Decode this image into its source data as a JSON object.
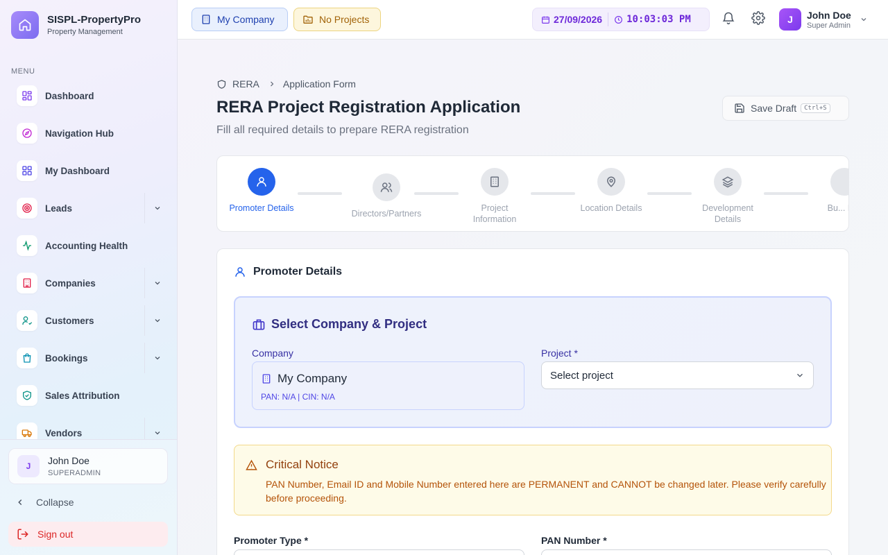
{
  "brand": {
    "name": "SISPL-PropertyPro",
    "subtitle": "Property Management"
  },
  "sidebar": {
    "menu_label": "MENU",
    "items": [
      {
        "label": "Dashboard",
        "icon": "layout-grid-icon",
        "color": "#7c3aed",
        "expandable": false
      },
      {
        "label": "Navigation Hub",
        "icon": "compass-icon",
        "color": "#c026d3",
        "expandable": false
      },
      {
        "label": "My Dashboard",
        "icon": "grid-icon",
        "color": "#4f46e5",
        "expandable": false
      },
      {
        "label": "Leads",
        "icon": "target-icon",
        "color": "#e11d48",
        "expandable": true
      },
      {
        "label": "Accounting Health",
        "icon": "activity-icon",
        "color": "#059669",
        "expandable": false
      },
      {
        "label": "Companies",
        "icon": "building-icon",
        "color": "#e11d48",
        "expandable": true
      },
      {
        "label": "Customers",
        "icon": "user-check-icon",
        "color": "#0d9488",
        "expandable": true
      },
      {
        "label": "Bookings",
        "icon": "shopping-bag-icon",
        "color": "#0891b2",
        "expandable": true
      },
      {
        "label": "Sales Attribution",
        "icon": "shield-check-icon",
        "color": "#0d9488",
        "expandable": false
      },
      {
        "label": "Vendors",
        "icon": "truck-icon",
        "color": "#d97706",
        "expandable": true
      }
    ],
    "user": {
      "initial": "J",
      "name": "John Doe",
      "role": "SUPERADMIN"
    },
    "collapse_label": "Collapse",
    "signout_label": "Sign out"
  },
  "header": {
    "company_chip": "My Company",
    "project_chip": "No Projects",
    "date": "27/09/2026",
    "time": "10:03:03 PM",
    "user": {
      "initial": "J",
      "name": "John Doe",
      "role": "Super Admin"
    }
  },
  "breadcrumb": {
    "root": "RERA",
    "current": "Application Form"
  },
  "page": {
    "title": "RERA Project Registration Application",
    "subtitle": "Fill all required details to prepare RERA registration",
    "save_draft": "Save Draft",
    "save_shortcut": "Ctrl+S"
  },
  "steps": [
    {
      "label": "Promoter Details",
      "icon": "user-icon",
      "active": true
    },
    {
      "label": "Directors/Partners",
      "icon": "users-icon",
      "active": false
    },
    {
      "label": "Project Information",
      "icon": "building-icon",
      "active": false
    },
    {
      "label": "Location Details",
      "icon": "map-pin-icon",
      "active": false
    },
    {
      "label": "Development Details",
      "icon": "layers-icon",
      "active": false
    },
    {
      "label": "Bu... D...",
      "icon": "building-icon",
      "active": false
    }
  ],
  "section": {
    "title": "Promoter Details",
    "select_box": {
      "title": "Select Company & Project",
      "company_label": "Company",
      "company_name": "My Company",
      "company_meta": "PAN: N/A | CIN: N/A",
      "project_label": "Project *",
      "project_value": "Select project"
    },
    "notice": {
      "title": "Critical Notice",
      "text": "PAN Number, Email ID and Mobile Number entered here are PERMANENT and CANNOT be changed later. Please verify carefully before proceeding."
    },
    "fields": {
      "promoter_type_label": "Promoter Type *",
      "pan_label": "PAN Number *"
    }
  },
  "colors": {
    "accent": "#2563eb",
    "brand": "#7c6cf0",
    "warning_bg": "#fefbe8",
    "danger": "#dc2626"
  }
}
